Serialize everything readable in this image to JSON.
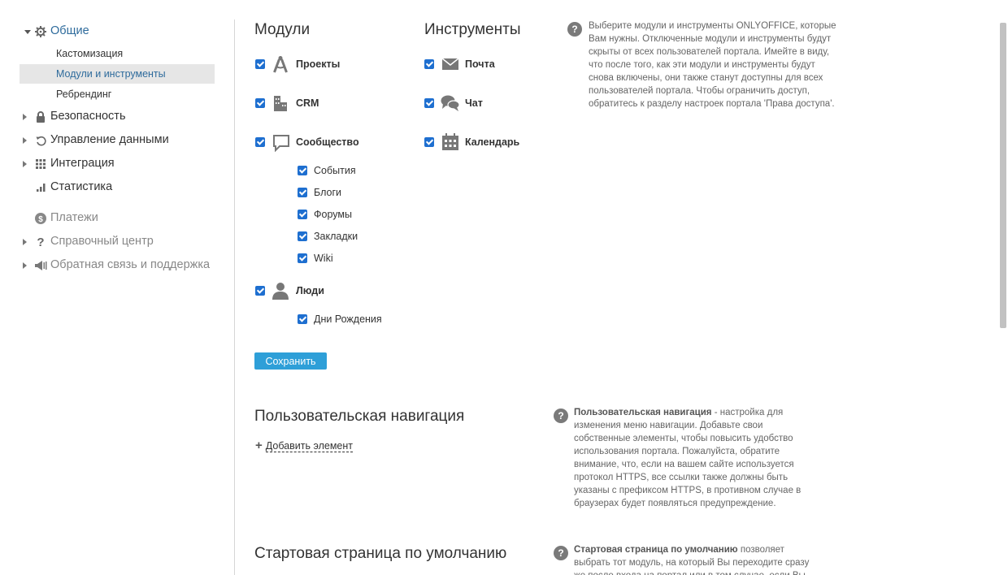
{
  "sidebar": {
    "general": {
      "label": "Общие",
      "icon": "gear-icon"
    },
    "subitems": [
      "Кастомизация",
      "Модули и инструменты",
      "Ребрендинг"
    ],
    "items": [
      {
        "label": "Безопасность",
        "icon": "lock-icon"
      },
      {
        "label": "Управление данными",
        "icon": "restore-icon"
      },
      {
        "label": "Интеграция",
        "icon": "grid-icon"
      },
      {
        "label": "Статистика",
        "icon": "bar-chart-icon"
      },
      {
        "label": "Платежи",
        "icon": "dollar-icon"
      },
      {
        "label": "Справочный центр",
        "icon": "question-icon"
      },
      {
        "label": "Обратная связь и поддержка",
        "icon": "megaphone-icon"
      }
    ]
  },
  "modules": {
    "title": "Модули",
    "projects": "Проекты",
    "crm": "CRM",
    "community": "Сообщество",
    "community_sub": [
      "События",
      "Блоги",
      "Форумы",
      "Закладки",
      "Wiki"
    ],
    "people": "Люди",
    "people_sub": [
      "Дни Рождения"
    ]
  },
  "tools": {
    "title": "Инструменты",
    "mail": "Почта",
    "chat": "Чат",
    "calendar": "Календарь"
  },
  "save_label": "Сохранить",
  "help_modules": "Выберите модули и инструменты ONLYOFFICE, которые Вам нужны. Отключенные модули и инструменты будут скрыты от всех пользователей портала. Имейте в виду, что после того, как эти модули и инструменты будут снова включены, они также станут доступны для всех пользователей портала. Чтобы ограничить доступ, обратитесь к разделу настроек портала 'Права доступа'.",
  "custom_nav": {
    "title": "Пользовательская навигация",
    "add_label": "Добавить элемент",
    "help_bold": "Пользовательская навигация",
    "help_rest": " - настройка для изменения меню навигации. Добавьте свои собственные элементы, чтобы повысить удобство использования портала. Пожалуйста, обратите внимание, что, если на вашем сайте используется протокол HTTPS, все ссылки также должны быть указаны с префиксом HTTPS, в противном случае в браузерах будет появляться предупреждение."
  },
  "start_page": {
    "title": "Стартовая страница по умолчанию",
    "help_bold": "Стартовая страница по умолчанию",
    "help_rest": " позволяет выбрать тот модуль, на который Вы переходите сразу же после входа на портал или в том случае, если Вы"
  },
  "colors": {
    "accent": "#2e9fd8",
    "checkbox": "#1e6fd0",
    "active_bg": "#e6e6e6"
  }
}
